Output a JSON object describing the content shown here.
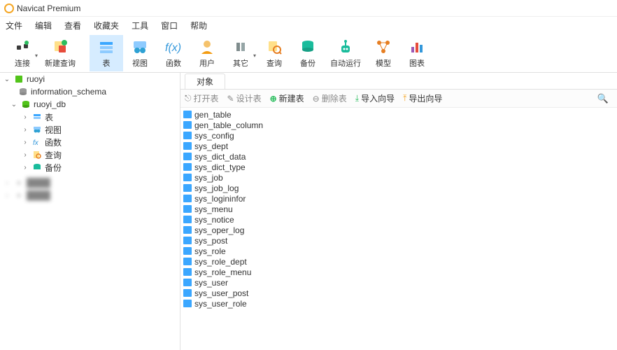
{
  "app_title": "Navicat Premium",
  "menu": [
    "文件",
    "编辑",
    "查看",
    "收藏夹",
    "工具",
    "窗口",
    "帮助"
  ],
  "toolbar": [
    {
      "id": "connect",
      "label": "连接",
      "color": "#3a3a3a",
      "dropdown": true
    },
    {
      "id": "newquery",
      "label": "新建查询",
      "color": "#e74c3c",
      "dropdown": false
    },
    {
      "id": "table",
      "label": "表",
      "color": "#3ba7ff",
      "dropdown": false,
      "active": true
    },
    {
      "id": "view",
      "label": "视图",
      "color": "#2ea1d4",
      "dropdown": false
    },
    {
      "id": "function",
      "label": "函数",
      "color": "#3498db",
      "dropdown": false,
      "text": "f(x)"
    },
    {
      "id": "user",
      "label": "用户",
      "color": "#f39c12",
      "dropdown": false
    },
    {
      "id": "other",
      "label": "其它",
      "color": "#7f8c8d",
      "dropdown": true
    },
    {
      "id": "query",
      "label": "查询",
      "color": "#e67e22",
      "dropdown": false
    },
    {
      "id": "backup",
      "label": "备份",
      "color": "#16a085",
      "dropdown": false
    },
    {
      "id": "automation",
      "label": "自动运行",
      "color": "#1abc9c",
      "dropdown": false
    },
    {
      "id": "model",
      "label": "模型",
      "color": "#e67e22",
      "dropdown": false
    },
    {
      "id": "chart",
      "label": "图表",
      "color": "#9b59b6",
      "dropdown": false
    }
  ],
  "tree": {
    "root": {
      "label": "ruoyi",
      "expanded": true,
      "color": "#52c41a"
    },
    "schema": {
      "label": "information_schema",
      "color": "#888"
    },
    "db": {
      "label": "ruoyi_db",
      "expanded": true,
      "color": "#52c41a"
    },
    "children": [
      {
        "id": "tables",
        "label": "表",
        "expanded": false,
        "color": "#3ba7ff"
      },
      {
        "id": "views",
        "label": "视图",
        "expanded": false,
        "color": "#2ea1d4"
      },
      {
        "id": "functions",
        "label": "函数",
        "expanded": false,
        "color": "#3498db",
        "text": "fx"
      },
      {
        "id": "queries",
        "label": "查询",
        "expanded": false,
        "color": "#e67e22"
      },
      {
        "id": "backups",
        "label": "备份",
        "expanded": false,
        "color": "#16a085"
      }
    ]
  },
  "tab": {
    "label": "对象"
  },
  "actions": {
    "open": "打开表",
    "design": "设计表",
    "new": "新建表",
    "delete": "删除表",
    "import": "导入向导",
    "export": "导出向导"
  },
  "tables": [
    "gen_table",
    "gen_table_column",
    "sys_config",
    "sys_dept",
    "sys_dict_data",
    "sys_dict_type",
    "sys_job",
    "sys_job_log",
    "sys_logininfor",
    "sys_menu",
    "sys_notice",
    "sys_oper_log",
    "sys_post",
    "sys_role",
    "sys_role_dept",
    "sys_role_menu",
    "sys_user",
    "sys_user_post",
    "sys_user_role"
  ]
}
